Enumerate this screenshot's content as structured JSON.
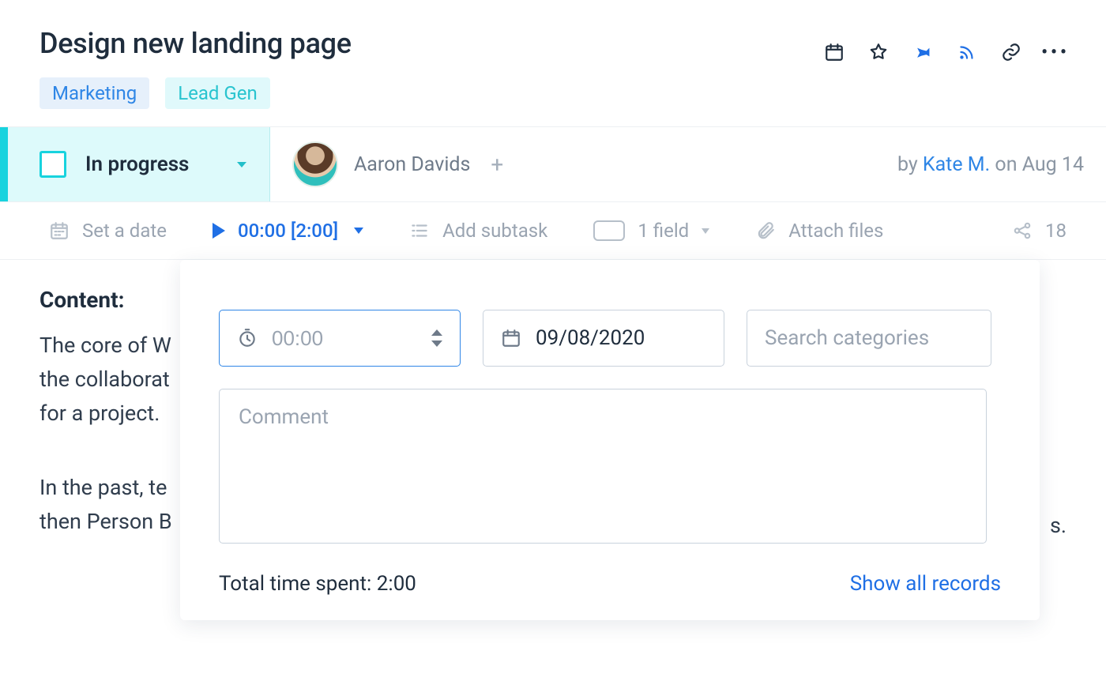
{
  "header": {
    "title": "Design new landing page"
  },
  "tags": [
    {
      "label": "Marketing",
      "style": "marketing"
    },
    {
      "label": "Lead Gen",
      "style": "leadgen"
    }
  ],
  "status": {
    "label": "In progress"
  },
  "assignee": {
    "name": "Aaron Davids"
  },
  "byline": {
    "prefix": "by ",
    "author": "Kate M.",
    "suffix": " on Aug 14"
  },
  "toolbar": {
    "set_date": "Set a date",
    "timer": "00:00 [2:00]",
    "add_subtask": "Add subtask",
    "fields": "1 field",
    "attach": "Attach files",
    "share_count": "18"
  },
  "content": {
    "heading": "Content:",
    "para1": "The core of W\nthe collaborat\nfor a project.",
    "para2": "In the past, te\nthen Person B"
  },
  "popover": {
    "duration_placeholder": "00:00",
    "date_value": "09/08/2020",
    "categories_placeholder": "Search categories",
    "comment_placeholder": "Comment",
    "total_label": "Total time spent: 2:00",
    "show_all": "Show all records"
  },
  "trailing_char": "s."
}
